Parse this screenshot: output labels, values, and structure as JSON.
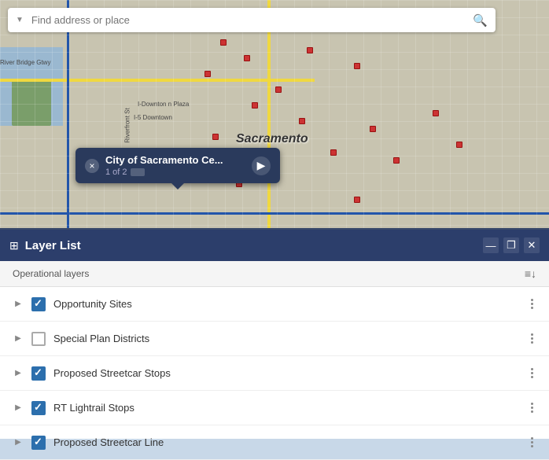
{
  "search": {
    "placeholder": "Find address or place",
    "value": ""
  },
  "map": {
    "popup": {
      "title": "City of Sacramento Ce...",
      "subtitle": "1 of 2",
      "close_label": "×",
      "next_label": "▶"
    },
    "label": "Sacramento"
  },
  "panel": {
    "title": "Layer List",
    "icon": "≡",
    "minimize_label": "—",
    "restore_label": "❐",
    "close_label": "✕",
    "section_label": "Operational layers",
    "filter_icon": "≡↓",
    "layers": [
      {
        "id": "opportunity-sites",
        "label": "Opportunity Sites",
        "checked": true,
        "expanded": false
      },
      {
        "id": "special-plan-districts",
        "label": "Special Plan Districts",
        "checked": false,
        "expanded": false
      },
      {
        "id": "proposed-streetcar-stops",
        "label": "Proposed Streetcar Stops",
        "checked": true,
        "expanded": false
      },
      {
        "id": "rt-lightrail-stops",
        "label": "RT Lightrail Stops",
        "checked": true,
        "expanded": false
      },
      {
        "id": "proposed-streetcar-line",
        "label": "Proposed Streetcar Line",
        "checked": true,
        "expanded": false
      }
    ]
  }
}
